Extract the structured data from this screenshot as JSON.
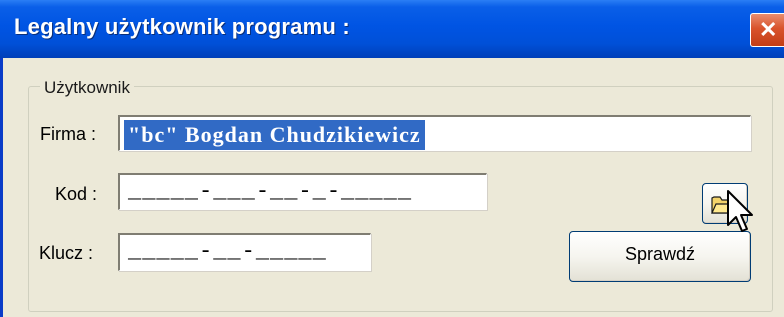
{
  "window": {
    "title": "Legalny użytkownik programu :",
    "close_symbol": "✕"
  },
  "group": {
    "legend": "Użytkownik"
  },
  "firma": {
    "label": "Firma :",
    "value": "\"bc\" Bogdan Chudzikiewicz"
  },
  "kod": {
    "label": "Kod :",
    "value": "_____-___-__-_-_____"
  },
  "klucz": {
    "label": "Klucz :",
    "value": "_____-__-_____"
  },
  "buttons": {
    "check_label": "Sprawdź",
    "folder_icon": "open-folder-icon"
  },
  "colors": {
    "title_bar": "#0054e3",
    "selection": "#316ac5",
    "dialog_bg": "#ece9d8",
    "close_button": "#d9532c"
  }
}
